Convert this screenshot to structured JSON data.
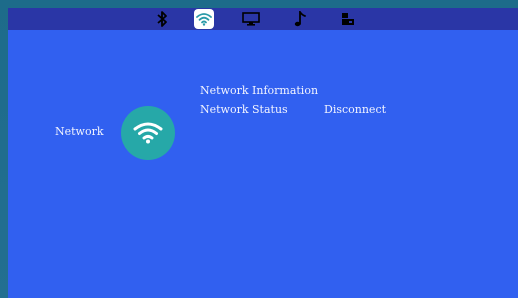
{
  "tabs": [
    {
      "icon": "bluetooth-icon",
      "active": false
    },
    {
      "icon": "wifi-icon",
      "active": true
    },
    {
      "icon": "monitor-icon",
      "active": false
    },
    {
      "icon": "music-note-icon",
      "active": false
    },
    {
      "icon": "storage-icon",
      "active": false
    }
  ],
  "sidebar": {
    "network_label": "Network"
  },
  "main": {
    "section_title": "Network Information",
    "status_label": "Network Status",
    "status_value": "Disconnect"
  },
  "colors": {
    "screen_bg": "#3160f0",
    "topbar_bg": "#2a36a6",
    "wifi_circle": "#26a8a8"
  }
}
